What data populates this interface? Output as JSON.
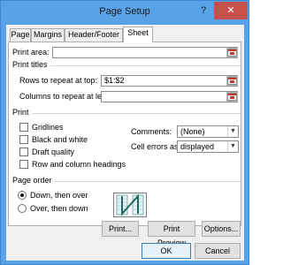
{
  "window": {
    "title": "Page Setup",
    "help_label": "?",
    "close_label": "✕"
  },
  "tabs": [
    {
      "label": "Page"
    },
    {
      "label": "Margins"
    },
    {
      "label": "Header/Footer"
    },
    {
      "label": "Sheet"
    }
  ],
  "print_area": {
    "label": "Print area:",
    "accel": "A",
    "value": ""
  },
  "print_titles": {
    "heading": "Print titles",
    "rows_label": "Rows to repeat at top:",
    "rows_value": "$1:$2",
    "cols_label": "Columns to repeat at left:",
    "cols_value": ""
  },
  "print": {
    "heading": "Print",
    "gridlines": {
      "label": "Gridlines",
      "checked": false
    },
    "black_white": {
      "label": "Black and white",
      "checked": false
    },
    "draft_quality": {
      "label": "Draft quality",
      "checked": false
    },
    "row_col_headings": {
      "label": "Row and column headings",
      "checked": false
    },
    "comments_label": "Comments:",
    "comments_value": "(None)",
    "cell_errors_label": "Cell errors as:",
    "cell_errors_value": "displayed"
  },
  "page_order": {
    "heading": "Page order",
    "down_then_over": {
      "label": "Down, then over",
      "selected": true
    },
    "over_then_down": {
      "label": "Over, then down",
      "selected": false
    }
  },
  "buttons": {
    "print": "Print...",
    "print_preview": "Print Preview",
    "options": "Options...",
    "ok": "OK",
    "cancel": "Cancel"
  },
  "colors": {
    "titlebar": "#5aa2e8",
    "close": "#c7504b",
    "ref_icon": "#c0392b"
  },
  "icons": {
    "range_selector": "collapse-dialog-icon",
    "page_order": "page-order-preview-icon"
  }
}
